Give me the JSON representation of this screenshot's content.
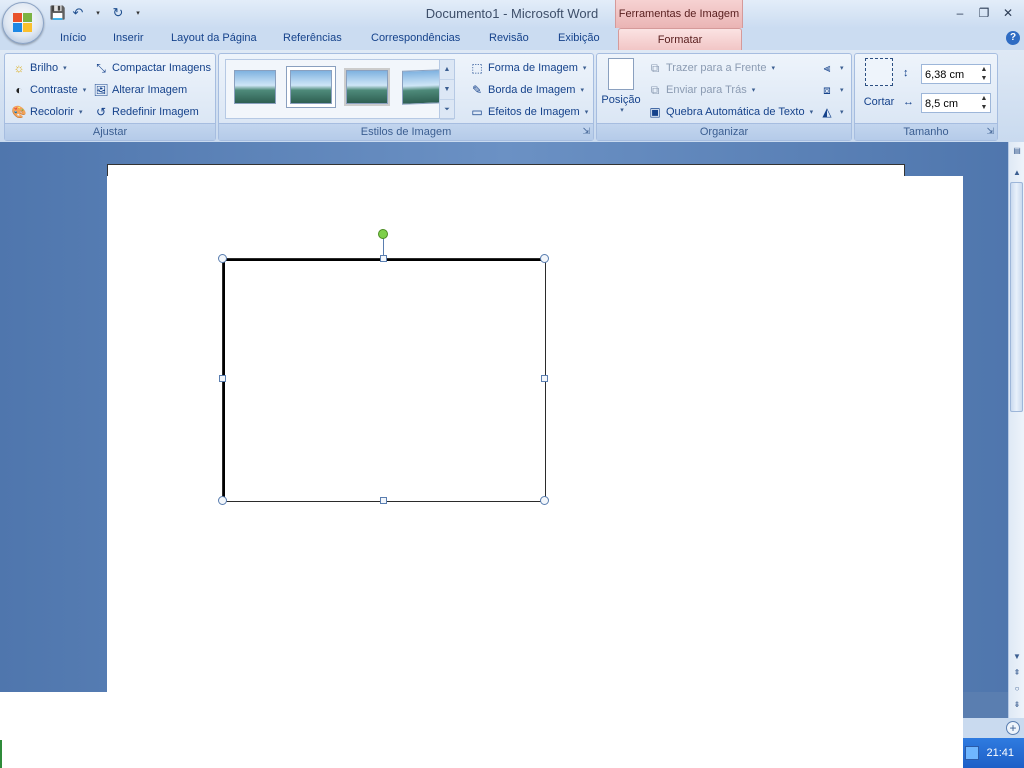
{
  "title_bar": {
    "title": "Documento1 - Microsoft Word",
    "context_tab": "Ferramentas de Imagem",
    "window_controls": [
      "–",
      "❐",
      "✕"
    ]
  },
  "tabs": [
    "Início",
    "Inserir",
    "Layout da Página",
    "Referências",
    "Correspondências",
    "Revisão",
    "Exibição",
    "Formatar"
  ],
  "active_tab": "Formatar",
  "ribbon": {
    "ajustar": {
      "label": "Ajustar",
      "brilho": "Brilho",
      "contraste": "Contraste",
      "recolorir": "Recolorir",
      "compactar": "Compactar Imagens",
      "alterar": "Alterar Imagem",
      "redefinir": "Redefinir Imagem"
    },
    "estilos": {
      "label": "Estilos de Imagem",
      "forma": "Forma de Imagem",
      "borda": "Borda de Imagem",
      "efeitos": "Efeitos de Imagem"
    },
    "organizar": {
      "label": "Organizar",
      "posicao": "Posição",
      "trazer": "Trazer para a Frente",
      "enviar": "Enviar para Trás",
      "quebra": "Quebra Automática de Texto"
    },
    "tamanho": {
      "label": "Tamanho",
      "cortar": "Cortar",
      "height": "6,38 cm",
      "width": "8,5 cm"
    }
  },
  "status": {
    "clock": "21:41"
  }
}
